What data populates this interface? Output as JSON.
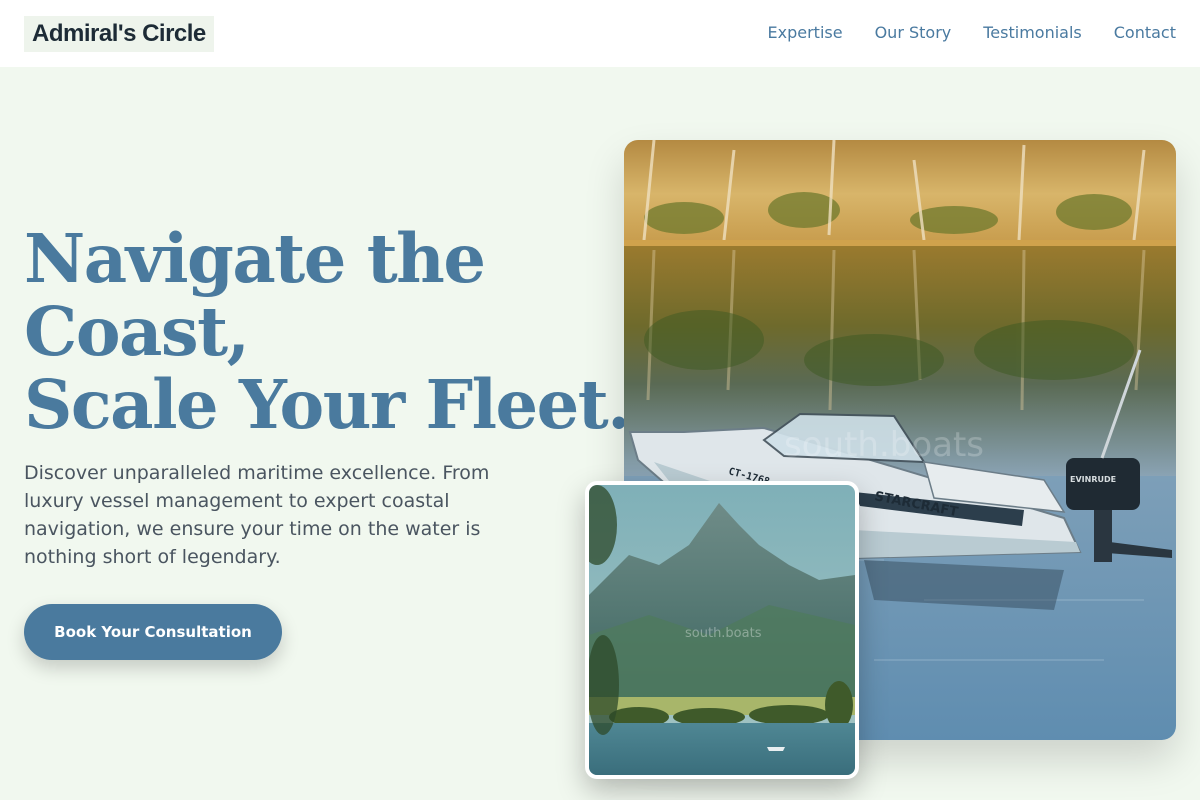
{
  "header": {
    "brand": "Admiral's Circle",
    "nav": [
      "Expertise",
      "Our Story",
      "Testimonials",
      "Contact"
    ]
  },
  "hero": {
    "headline_lines": [
      "Navigate the",
      "Coast,",
      "Scale Your Fleet."
    ],
    "description": "Discover unparalleled maritime excellence. From luxury vessel management to expert coastal navigation, we ensure your time on the water is nothing short of legendary.",
    "cta_label": "Book Your Consultation"
  },
  "images": {
    "main": {
      "boat_brand": "STARCRAFT",
      "registration": "CT-1768",
      "engine_brand": "EVINRUDE",
      "watermark": "south.boats"
    },
    "inset": {
      "watermark": "south.boats"
    }
  },
  "colors": {
    "accent": "#4a7a9e",
    "background": "#f1f8ef",
    "body_text": "#4a5560",
    "brand_text": "#1d2b36"
  }
}
